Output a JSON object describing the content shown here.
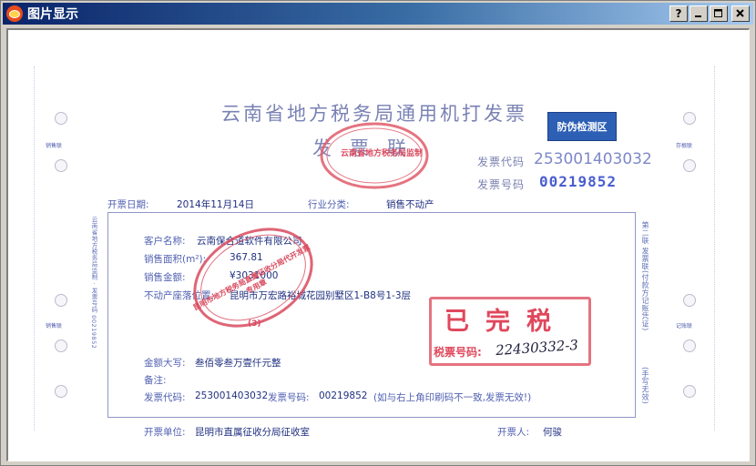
{
  "window": {
    "title": "图片显示",
    "buttons": {
      "help": "?",
      "minimize": "_",
      "maximize": "□",
      "close": "×"
    }
  },
  "invoice": {
    "title": "云南省地方税务局通用机打发票",
    "subtitle": "发票联",
    "anti_fake_badge": "防伪检测区",
    "code_label": "发票代码",
    "code_value": "253001403032",
    "number_label": "发票号码",
    "number_value": "00219852",
    "date_label": "开票日期:",
    "date_value": "2014年11月14日",
    "industry_label": "行业分类:",
    "industry_value": "销售不动产",
    "side_left_top": "销售联",
    "side_left_mid": "销售联",
    "side_right_top": "存根联",
    "side_right_mid": "记账联",
    "side_right_label": "第二联 发票联(付款方记账凭证)",
    "side_right_note": "(手写无效)",
    "fields": {
      "customer_label": "客户名称:",
      "customer_value": "云南保合道软件有限公司",
      "area_label": "销售面积(m²):",
      "area_value": "367.81",
      "amount_label": "销售金额:",
      "amount_value": "¥3031000",
      "address_label": "不动产座落位置:",
      "address_value": "昆明市万宏路裕城花园别墅区1-B8号1-3层",
      "total_upper_label": "金额大写:",
      "total_upper_value": "叁佰零叁万壹仟元整",
      "remark_label": "备注:",
      "footer_code_label": "发票代码:",
      "footer_code_value": "253001403032",
      "footer_number_label": "发票号码:",
      "footer_number_value": "00219852",
      "footer_note": "(如与右上角印刷码不一致,发票无效!)"
    },
    "issuer_label": "开票单位:",
    "issuer_value": "昆明市直属征收分局征收室",
    "drawer_label": "开票人:",
    "drawer_value": "何骏",
    "stamp_paid": "已完税",
    "stamp_taxno_label": "税票号码:",
    "stamp_taxno_value": "22430332-3",
    "seal_top_text": "云南省地方税务局监制",
    "seal_bottom_text": "昆明市地方税务局直属征收分局代开发票专用章",
    "seal_bottom_no": "(3)"
  },
  "colors": {
    "titlebar_start": "#0a246a",
    "badge": "#2d5fb5",
    "stamp_red": "#e0485c"
  }
}
